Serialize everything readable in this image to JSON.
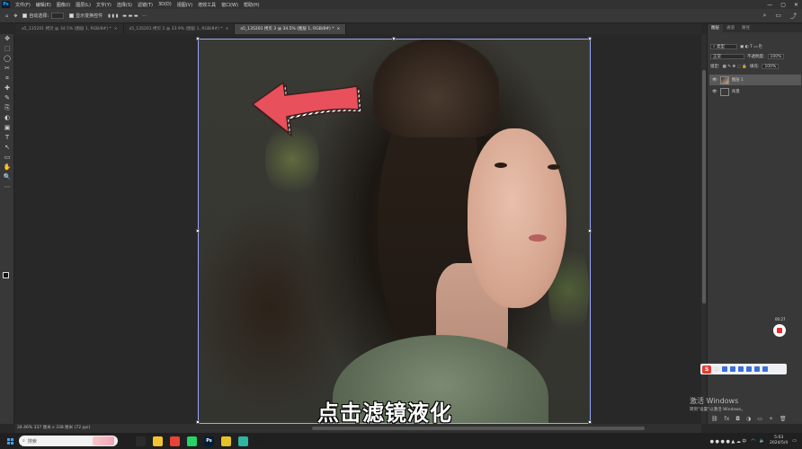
{
  "app": {
    "logo": "Ps"
  },
  "menubar": {
    "items": [
      "文件(F)",
      "编辑(E)",
      "图像(I)",
      "图层(L)",
      "文字(Y)",
      "选择(S)",
      "滤镜(T)",
      "3D(D)",
      "视图(V)",
      "增效工具",
      "窗口(W)",
      "帮助(H)"
    ],
    "window_controls": [
      "—",
      "▢",
      "✕"
    ]
  },
  "options": {
    "auto_select_label": "自动选择:",
    "show_transform_label": "显示变换控件"
  },
  "tabs": [
    {
      "label": "a5_135201 拷贝 @ 34.5% (图层 1, RGB/8#) *",
      "active": false
    },
    {
      "label": "a5_135201 拷贝 2 @ 33.9% (图层 1, RGB/8#) *",
      "active": false
    },
    {
      "label": "a5_135201 拷贝 3 @ 34.5% (图层 1, RGB/8#) *",
      "active": true
    }
  ],
  "tab_close": "×",
  "tools": [
    "✥",
    "⬚",
    "◯",
    "✂",
    "⌗",
    "✚",
    "✎",
    "⎘",
    "◐",
    "▣",
    "T",
    "↖",
    "▭",
    "✋",
    "🔍",
    "⋯"
  ],
  "canvas": {
    "subtitle": "点击滤镜液化"
  },
  "statusbar": {
    "text": "34.46%  337 厘米 x 338 厘米 (72 ppi)"
  },
  "panel": {
    "tabs": [
      "图层",
      "通道",
      "路径"
    ],
    "blend_mode": "正常",
    "opacity_label": "不透明度:",
    "opacity_value": "100%",
    "lock_label": "锁定:",
    "fill_label": "填充:",
    "fill_value": "100%",
    "layers": [
      {
        "name": "图层 1",
        "selected": true
      },
      {
        "name": "背景",
        "selected": false
      }
    ],
    "bottom_icons": [
      "⛓",
      "fx",
      "◘",
      "◑",
      "▭",
      "+",
      "🗑"
    ]
  },
  "recorder": {
    "time": "00:27"
  },
  "ime": {
    "logo": "S"
  },
  "activate_windows": {
    "title": "激活 Windows",
    "subtitle": "转到\"设置\"以激活 Windows。"
  },
  "taskbar": {
    "search_placeholder": "搜索",
    "apps": [
      {
        "label": "",
        "color": "#2b2b2b"
      },
      {
        "label": "",
        "color": "#f4c430"
      },
      {
        "label": "",
        "color": "#ea4335"
      },
      {
        "label": "",
        "color": "#25d366"
      },
      {
        "label": "Ps",
        "color": "#001e36"
      },
      {
        "label": "",
        "color": "#e6c229"
      },
      {
        "label": "",
        "color": "#2fb5a0"
      },
      {
        "label": "",
        "color": "#1f1f1f"
      }
    ],
    "time": "5:03",
    "date": "2024/5/4"
  },
  "colors": {
    "arrow_fill": "#e8505b",
    "arrow_stripe": "#ffffff",
    "selection_frame": "#9aa8ff"
  }
}
